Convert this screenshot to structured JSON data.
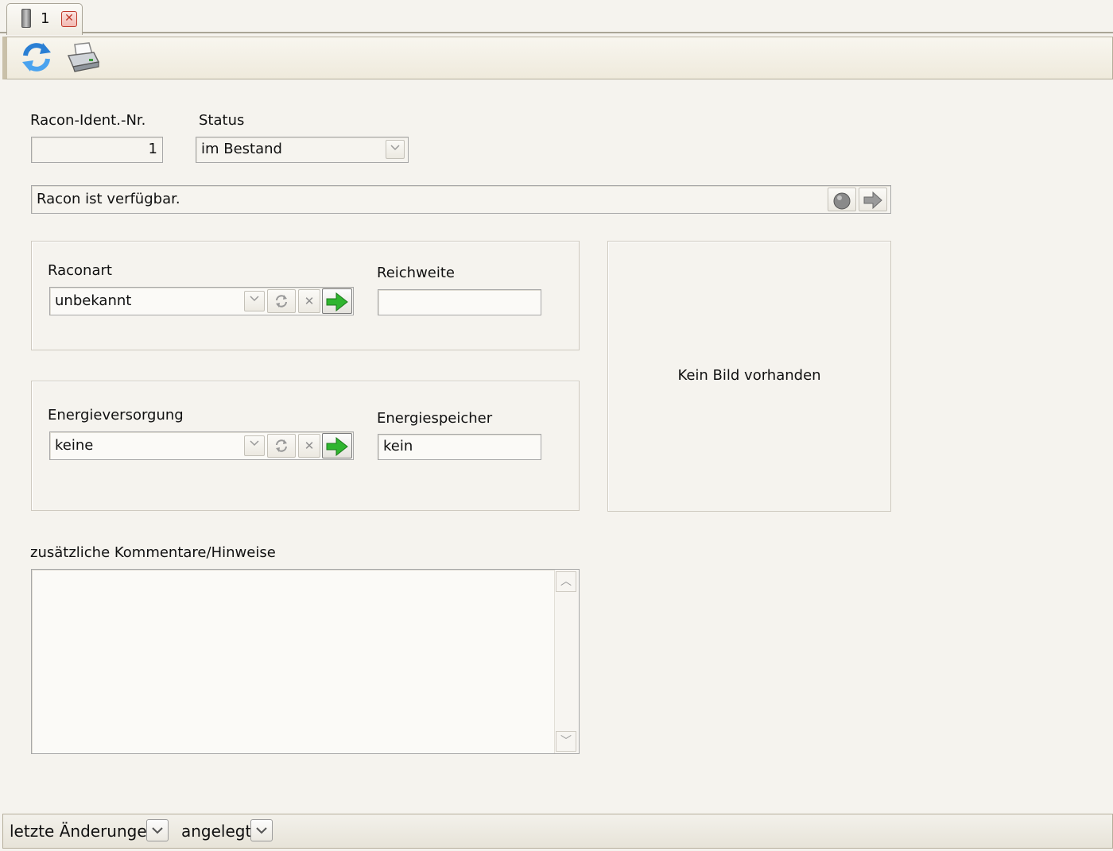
{
  "tab": {
    "label": "1"
  },
  "form": {
    "ident_label": "Racon-Ident.-Nr.",
    "ident_value": "1",
    "status_label": "Status",
    "status_value": "im Bestand",
    "availability_text": "Racon ist verfügbar.",
    "raconart_label": "Raconart",
    "raconart_value": "unbekannt",
    "reichweite_label": "Reichweite",
    "reichweite_value": "",
    "energieversorgung_label": "Energieversorgung",
    "energieversorgung_value": "keine",
    "energiespeicher_label": "Energiespeicher",
    "energiespeicher_value": "kein",
    "image_placeholder": "Kein Bild vorhanden",
    "comments_label": "zusätzliche Kommentare/Hinweise",
    "comments_value": ""
  },
  "bottom": {
    "last_changes_label": "letzte Änderungen",
    "created_label": "angelegt"
  }
}
